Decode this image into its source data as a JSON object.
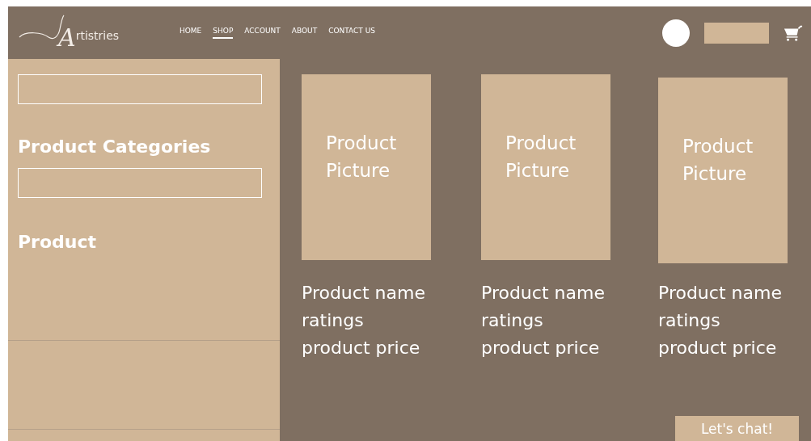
{
  "header": {
    "logo": "rtistries",
    "logo_initial": "A",
    "nav": [
      {
        "label": "HOME",
        "selected": false
      },
      {
        "label": "SHOP",
        "selected": true
      },
      {
        "label": "ACCOUNT",
        "selected": false
      },
      {
        "label": "ABOUT",
        "selected": false
      },
      {
        "label": "CONTACT US",
        "selected": false
      }
    ]
  },
  "sidebar": {
    "headings": [
      "Product Categories",
      "Product"
    ]
  },
  "products": [
    {
      "picture_label": "Product Picture",
      "name": "Product name",
      "ratings": "ratings",
      "price": "product price"
    },
    {
      "picture_label": "Product Picture",
      "name": "Product name",
      "ratings": "ratings",
      "price": "product price"
    },
    {
      "picture_label": "Product Picture",
      "name": "Product name",
      "ratings": "ratings",
      "price": "product price"
    }
  ],
  "chat_button": "Let's chat!"
}
